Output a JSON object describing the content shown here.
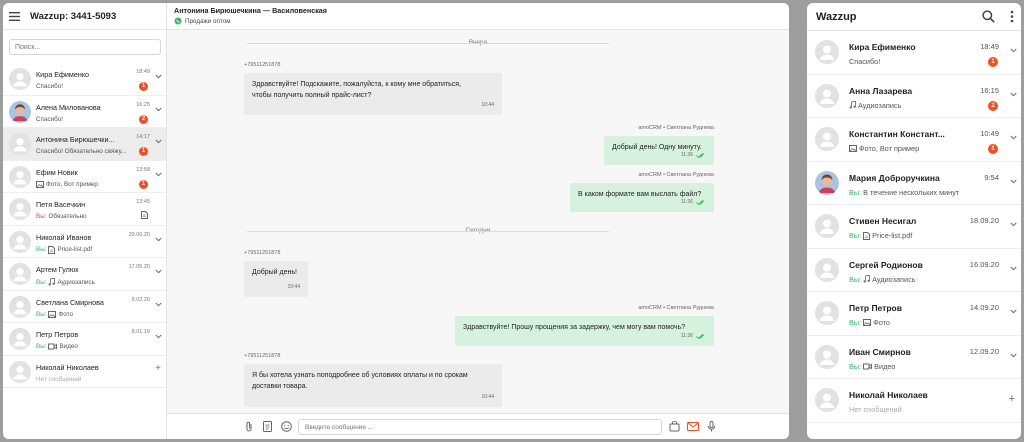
{
  "desktop": {
    "sidebar": {
      "title": "Wazzup: 3441-5093",
      "search_placeholder": "Поиск...",
      "chats": [
        {
          "name": "Кира Ефименко",
          "preview": "Спасибо!",
          "time": "18:49",
          "badge": "1",
          "you": false,
          "icon": "",
          "avatar": "default",
          "trail": "chevron"
        },
        {
          "name": "Алена Милованова",
          "preview": "Спасибо!",
          "time": "16:25",
          "badge": "2",
          "you": false,
          "icon": "",
          "avatar": "photo",
          "trail": "chevron"
        },
        {
          "name": "Антонина Бирюшечки...",
          "preview": "Спасибо! Обязательно свяжу...",
          "time": "14:17",
          "badge": "1",
          "you": false,
          "icon": "",
          "avatar": "default",
          "trail": "chevron",
          "selected": true
        },
        {
          "name": "Ефим Новик",
          "preview": "Фото, Вот пример",
          "time": "13:58",
          "badge": "1",
          "you": false,
          "icon": "image",
          "avatar": "default",
          "trail": "chevron"
        },
        {
          "name": "Петя Васечкин",
          "preview": "Обязательно",
          "time": "13:45",
          "badge": "",
          "you": true,
          "youColor": "red",
          "icon": "",
          "avatar": "default",
          "trail": "doc"
        },
        {
          "name": "Николай Иванов",
          "preview": "Price-list.pdf",
          "time": "29.06.20",
          "badge": "",
          "you": true,
          "icon": "doc",
          "avatar": "default",
          "trail": "chevron"
        },
        {
          "name": "Артем Гулюк",
          "preview": "Аудиозапись",
          "time": "17.05.20",
          "badge": "",
          "you": true,
          "icon": "note",
          "avatar": "default",
          "trail": "chevron"
        },
        {
          "name": "Светлана Смирнова",
          "preview": "Фото",
          "time": "9.02.20",
          "badge": "",
          "you": true,
          "icon": "image",
          "avatar": "default",
          "trail": "chevron"
        },
        {
          "name": "Петр Петров",
          "preview": "Видео",
          "time": "8.01.19",
          "badge": "",
          "you": true,
          "icon": "video",
          "avatar": "default",
          "trail": "chevron"
        },
        {
          "name": "Николай Николаев",
          "preview": "Нет сообщений",
          "time": "",
          "badge": "",
          "you": false,
          "icon": "",
          "avatar": "default",
          "trail": "plus",
          "empty": true
        }
      ],
      "you_label": "Вы:"
    },
    "chat": {
      "title": "Антонина Бирюшечкина — Василовенская",
      "subtitle": "Продажи оптом",
      "date_yesterday": "Вчера",
      "date_today": "Сегодни",
      "messages": [
        {
          "dir": "in",
          "sender": "+79511251878",
          "text_lines": [
            "Здравствуйте! Подскажите, пожалуйста, к кому мне обратиться,",
            "чтобы получить полный прайс-лист?"
          ],
          "time": "10:44"
        },
        {
          "dir": "out",
          "sender": "amoCRM • Светлана Руднева",
          "text_lines": [
            "Добрый день! Одну минуту."
          ],
          "time": "11:36"
        },
        {
          "dir": "out",
          "sender": "amoCRM • Светлана Руднева",
          "text_lines": [
            "В каком формате вам выслать файл?"
          ],
          "time": "11:36"
        },
        {
          "dir": "in",
          "sender": "+79511251878",
          "text_lines": [
            "Добрый день!"
          ],
          "time": "10:44"
        },
        {
          "dir": "out",
          "sender": "amoCRM • Светлана Руднева",
          "text_lines": [
            "Здравствуйте! Прошу прощения за задержку, чем могу вам помочь?"
          ],
          "time": "11:36"
        },
        {
          "dir": "in",
          "sender": "+79511251878",
          "text_lines": [
            "Я бы хотела узнать поподробнее об условиях оплаты и по срокам",
            "доставки товара."
          ],
          "time": "10:44"
        }
      ],
      "input_placeholder": "Введите сообщение ..."
    }
  },
  "mobile": {
    "title": "Wazzup",
    "chats": [
      {
        "name": "Кира Ефименко",
        "preview": "Спасибо!",
        "time": "18:49",
        "badge": "1",
        "you": false,
        "icon": "",
        "avatar": "default",
        "trail": "chevron"
      },
      {
        "name": "Анна Лазарева",
        "preview": "Аудиозапись",
        "time": "16:15",
        "badge": "2",
        "you": false,
        "icon": "note",
        "avatar": "default",
        "trail": "chevron"
      },
      {
        "name": "Константин Констант...",
        "preview": "Фото, Вот пример",
        "time": "10:49",
        "badge": "1",
        "you": false,
        "icon": "image",
        "avatar": "default",
        "trail": "chevron"
      },
      {
        "name": "Мария Доброручкина",
        "preview": "В течение нескольких минут ва...",
        "time": "9:54",
        "badge": "",
        "you": true,
        "icon": "",
        "avatar": "photo",
        "trail": "chevron"
      },
      {
        "name": "Стивен Несигал",
        "preview": "Price-list.pdf",
        "time": "18.09.20",
        "badge": "",
        "you": true,
        "icon": "doc",
        "avatar": "default",
        "trail": "chevron"
      },
      {
        "name": "Сергей Родионов",
        "preview": "Аудиозапись",
        "time": "16.09.20",
        "badge": "",
        "you": true,
        "icon": "note",
        "avatar": "default",
        "trail": "chevron"
      },
      {
        "name": "Петр Петров",
        "preview": "Фото",
        "time": "14.09.20",
        "badge": "",
        "you": true,
        "icon": "image",
        "avatar": "default",
        "trail": "chevron"
      },
      {
        "name": "Иван Смирнов",
        "preview": "Видео",
        "time": "12.09.20",
        "badge": "",
        "you": true,
        "icon": "video",
        "avatar": "default",
        "trail": "chevron"
      },
      {
        "name": "Николай Николаев",
        "preview": "Нет сообщений",
        "time": "",
        "badge": "",
        "you": false,
        "icon": "",
        "avatar": "default",
        "trail": "plus",
        "empty": true
      }
    ],
    "you_label": "Вы:"
  },
  "colors": {
    "accent_green": "#3bb36a",
    "badge": "#f04e23",
    "out_bubble": "#d6f2df",
    "in_bubble": "#ebebeb"
  }
}
